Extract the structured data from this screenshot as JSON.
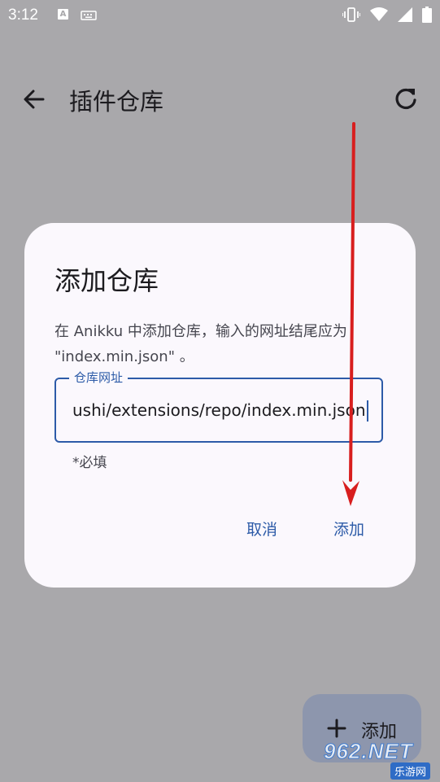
{
  "status_bar": {
    "time": "3:12",
    "notification_icon": "A",
    "keyboard_icon": "keyboard-icon",
    "right_icons": [
      "vibrate-icon",
      "wifi-icon",
      "signal-icon",
      "battery-icon"
    ]
  },
  "app_bar": {
    "title": "插件仓库",
    "back_icon": "arrow-left-icon",
    "refresh_icon": "refresh-icon"
  },
  "dialog": {
    "title": "添加仓库",
    "message": "在 Anikku 中添加仓库，输入的网址结尾应为 \"index.min.json\" 。",
    "field": {
      "label": "仓库网址",
      "value": "ushi/extensions/repo/index.min.json",
      "supporting_text": "*必填"
    },
    "cancel_label": "取消",
    "confirm_label": "添加"
  },
  "fab": {
    "label": "添加",
    "icon": "plus-icon"
  },
  "watermark": {
    "main": "962.NET",
    "sub": "乐游网"
  },
  "colors": {
    "primary": "#2d5ba8",
    "scrim_background": "#a9a8ab",
    "dialog_surface": "#fbf8fd",
    "annotation_arrow": "#d81e1e"
  }
}
